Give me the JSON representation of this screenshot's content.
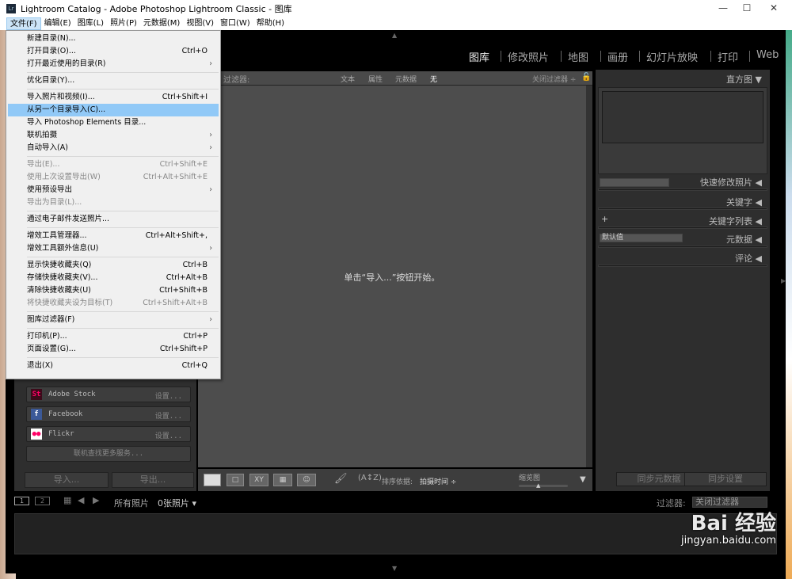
{
  "window": {
    "title": "Lightroom Catalog - Adobe Photoshop Lightroom Classic - 图库",
    "logo": "Lr",
    "minimize": "—",
    "maximize": "☐",
    "close": "✕"
  },
  "menubar": [
    "文件(F)",
    "编辑(E)",
    "图库(L)",
    "照片(P)",
    "元数据(M)",
    "视图(V)",
    "窗口(W)",
    "帮助(H)"
  ],
  "modules": [
    "图库",
    "修改照片",
    "地图",
    "画册",
    "幻灯片放映",
    "打印",
    "Web"
  ],
  "file_menu": [
    {
      "label": "新建目录(N)..."
    },
    {
      "label": "打开目录(O)...",
      "shortcut": "Ctrl+O"
    },
    {
      "label": "打开最近使用的目录(R)",
      "submenu": true
    },
    {
      "sep": true
    },
    {
      "label": "优化目录(Y)..."
    },
    {
      "sep": true
    },
    {
      "label": "导入照片和视频(I)...",
      "shortcut": "Ctrl+Shift+I"
    },
    {
      "label": "从另一个目录导入(C)...",
      "highlighted": true
    },
    {
      "label": "导入 Photoshop Elements 目录..."
    },
    {
      "label": "联机拍摄",
      "submenu": true
    },
    {
      "label": "自动导入(A)",
      "submenu": true
    },
    {
      "sep": true
    },
    {
      "label": "导出(E)...",
      "shortcut": "Ctrl+Shift+E",
      "disabled": true
    },
    {
      "label": "使用上次设置导出(W)",
      "shortcut": "Ctrl+Alt+Shift+E",
      "disabled": true
    },
    {
      "label": "使用预设导出",
      "submenu": true
    },
    {
      "label": "导出为目录(L)...",
      "disabled": true
    },
    {
      "sep": true
    },
    {
      "label": "通过电子邮件发送照片..."
    },
    {
      "sep": true
    },
    {
      "label": "增效工具管理器...",
      "shortcut": "Ctrl+Alt+Shift+,"
    },
    {
      "label": "增效工具额外信息(U)",
      "submenu": true
    },
    {
      "sep": true
    },
    {
      "label": "显示快捷收藏夹(Q)",
      "shortcut": "Ctrl+B"
    },
    {
      "label": "存储快捷收藏夹(V)...",
      "shortcut": "Ctrl+Alt+B"
    },
    {
      "label": "清除快捷收藏夹(U)",
      "shortcut": "Ctrl+Shift+B"
    },
    {
      "label": "将快捷收藏夹设为目标(T)",
      "shortcut": "Ctrl+Shift+Alt+B",
      "disabled": true
    },
    {
      "sep": true
    },
    {
      "label": "图库过滤器(F)",
      "submenu": true
    },
    {
      "sep": true
    },
    {
      "label": "打印机(P)...",
      "shortcut": "Ctrl+P"
    },
    {
      "label": "页面设置(G)...",
      "shortcut": "Ctrl+Shift+P"
    },
    {
      "sep": true
    },
    {
      "label": "退出(X)",
      "shortcut": "Ctrl+Q"
    }
  ],
  "filter": {
    "label": "过滤器:",
    "tabs": [
      "文本",
      "属性",
      "元数据",
      "无"
    ],
    "preset": "关闭过滤器 ÷"
  },
  "grid": {
    "prompt": "单击“导入...”按钮开始。"
  },
  "toolbar": {
    "sort_label": "排序依据:",
    "sort_value": "拍摄时间 ÷",
    "thumb_label": "缩览图",
    "xy": "XY"
  },
  "right_panel": {
    "histogram": "直方图 ▼",
    "quick_develop": "快速修改照片 ◀",
    "keywording": "关键字 ◀",
    "keyword_list": "关键字列表 ◀",
    "metadata": "元数据 ◀",
    "metadata_preset": "默认值",
    "comments": "评论 ◀",
    "plus": "+",
    "sync_metadata": "同步元数据",
    "sync_settings": "同步设置"
  },
  "left_panel": {
    "services": [
      {
        "icon": "St",
        "name": "Adobe Stock",
        "setup": "设置..."
      },
      {
        "icon": "f",
        "name": "Facebook",
        "setup": "设置..."
      },
      {
        "icon": "●●",
        "name": "Flickr",
        "setup": "设置..."
      }
    ],
    "find_more": "联机查找更多服务...",
    "import": "导入...",
    "export": "导出..."
  },
  "filmstrip": {
    "screen1": "1",
    "screen2": "2",
    "source": "所有照片",
    "count": "0张照片 ▾",
    "filter_label": "过滤器:",
    "filter_value": "关闭过滤器"
  },
  "colors": {
    "highlight": "#91c9f7",
    "panel": "#2e2e2e",
    "grid": "#4d4d4d"
  },
  "watermark": {
    "brand": "Bai 经验",
    "url": "jingyan.baidu.com"
  }
}
